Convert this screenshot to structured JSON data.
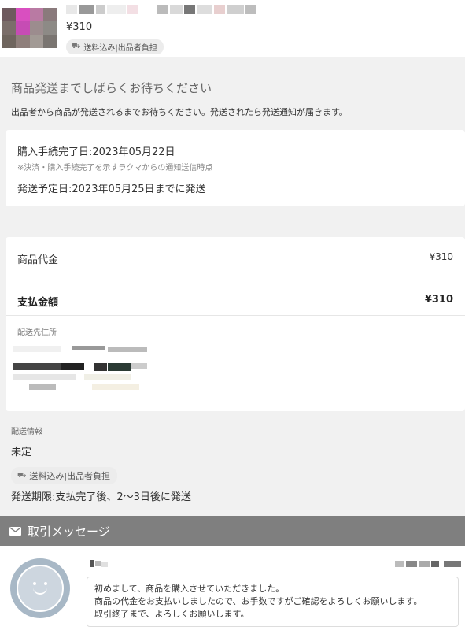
{
  "product": {
    "price": "¥310",
    "shipping_badge": "送料込み|出品者負担"
  },
  "waiting": {
    "title": "商品発送までしばらくお待ちください",
    "description": "出品者から商品が発送されるまでお待ちください。発送されたら発送通知が届きます。"
  },
  "purchase_info": {
    "completed": "購入手続完了日:2023年05月22日",
    "note": "※決済・購入手続完了を示すラクマからの通知送信時点",
    "scheduled": "発送予定日:2023年05月25日までに発送"
  },
  "payment": {
    "item_label": "商品代金",
    "item_value": "¥310",
    "total_label": "支払金額",
    "total_value": "¥310",
    "address_label": "配送先住所"
  },
  "shipping": {
    "label": "配送情報",
    "value": "未定",
    "badge": "送料込み|出品者負担",
    "period": "発送期限:支払完了後、2〜3日後に発送"
  },
  "messages": {
    "header": "取引メッセージ",
    "items": [
      {
        "lines": [
          "初めまして、商品を購入させていただきました。",
          "商品の代金をお支払いしましたので、お手数ですがご確認をよろしくお願いします。",
          "取引終了まで、よろしくお願いします。"
        ]
      }
    ]
  },
  "icons": {
    "truck": "truck-icon",
    "mail": "mail-icon",
    "avatar": "avatar-icon"
  },
  "colors": {
    "header_bar": "#7f7f7f",
    "background": "#f1f1f1"
  }
}
